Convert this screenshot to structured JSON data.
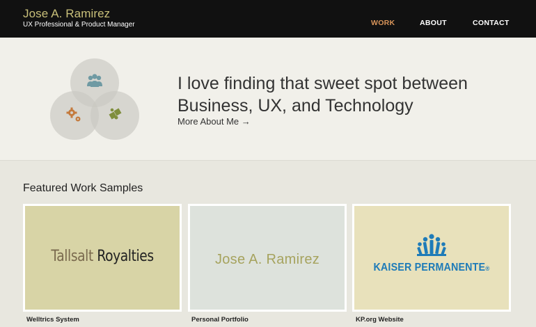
{
  "header": {
    "name": "Jose A. Ramirez",
    "tagline": "UX Professional & Product Manager",
    "nav": [
      {
        "label": "WORK",
        "active": true
      },
      {
        "label": "ABOUT",
        "active": false
      },
      {
        "label": "CONTACT",
        "active": false
      }
    ]
  },
  "hero": {
    "headline_line1": "I love finding that sweet spot between",
    "headline_line2": "Business, UX, and Technology",
    "link": "More About Me →",
    "icons": [
      "people-icon",
      "gears-icon",
      "puzzle-icon"
    ]
  },
  "featured": {
    "title": "Featured Work Samples",
    "cards": [
      {
        "logo_word1": "Tallsalt",
        "logo_word2": "Royalties",
        "caption": "Welltrics System"
      },
      {
        "logo_text": "Jose A. Ramirez",
        "caption": "Personal Portfolio"
      },
      {
        "logo_text": "KAISER PERMANENTE",
        "logo_mark": "®",
        "caption": "KP.org Website"
      }
    ]
  },
  "colors": {
    "header_bg": "#111111",
    "brand": "#c9c07a",
    "nav_active": "#d9955a",
    "kaiser_blue": "#1e7bb8"
  }
}
